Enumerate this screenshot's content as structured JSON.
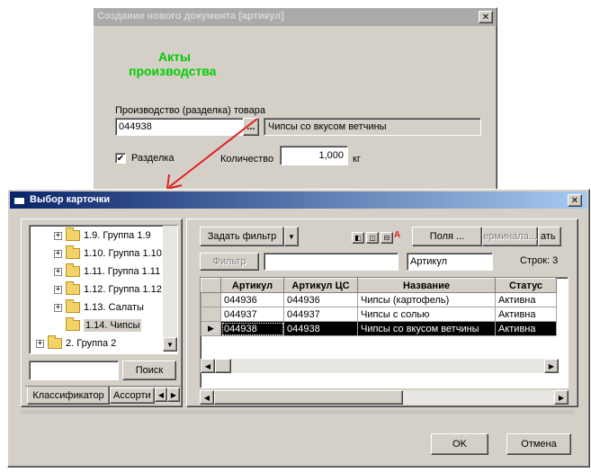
{
  "background_dialog": {
    "title": "Создание нового документа [артикул]",
    "heading_line1": "Акты",
    "heading_line2": "производства",
    "field_label": "Производство (разделка) товара",
    "article_value": "044938",
    "browse_label": "...",
    "product_name": "Чипсы со вкусом ветчины",
    "checkbox_label": "Разделка",
    "checkbox_checked": true,
    "quantity_label": "Количество",
    "quantity_value": "1,000",
    "unit": "кг",
    "close_label": "✕"
  },
  "main_dialog": {
    "title": "Выбор карточки",
    "close_label": "✕",
    "tree": {
      "items": [
        {
          "label": "1.9. Группа 1.9",
          "expander": "+"
        },
        {
          "label": "1.10. Группа 1.10",
          "expander": "+"
        },
        {
          "label": "1.11. Группа 1.11",
          "expander": "+"
        },
        {
          "label": "1.12. Группа 1.12",
          "expander": "+"
        },
        {
          "label": "1.13. Салаты",
          "expander": "+"
        },
        {
          "label": "1.14. Чипсы",
          "expander": ""
        },
        {
          "label": "2. Группа 2",
          "expander": "+"
        }
      ]
    },
    "search": {
      "value": "",
      "button_label": "Поиск"
    },
    "tabs": [
      "Классификатор",
      "Ассорти"
    ],
    "toolbar": {
      "set_filter_label": "Задать фильтр",
      "fields_label": "Поля ...",
      "terminal_label": "ерминала...",
      "tail_label": "ать",
      "filter_label": "Фильтр",
      "filter_value": "",
      "column_select_value": "Артикул",
      "rows_label": "Строк: 3"
    },
    "grid": {
      "columns": [
        "Артикул",
        "Артикул ЦС",
        "Название",
        "Статус"
      ],
      "rows": [
        [
          "044936",
          "044936",
          "Чипсы (картофель)",
          "Активна"
        ],
        [
          "044937",
          "044937",
          "Чипсы с солью",
          "Активна"
        ],
        [
          "044938",
          "044938",
          "Чипсы со вкусом ветчины",
          "Активна"
        ]
      ],
      "selected_row": 2
    },
    "ok_label": "OK",
    "cancel_label": "Отмена"
  },
  "colors": {
    "heading_green": "#00cc00",
    "arrow_red": "#e02020",
    "title_gradient_start": "#0a246a",
    "title_gradient_end": "#a6caf0"
  }
}
